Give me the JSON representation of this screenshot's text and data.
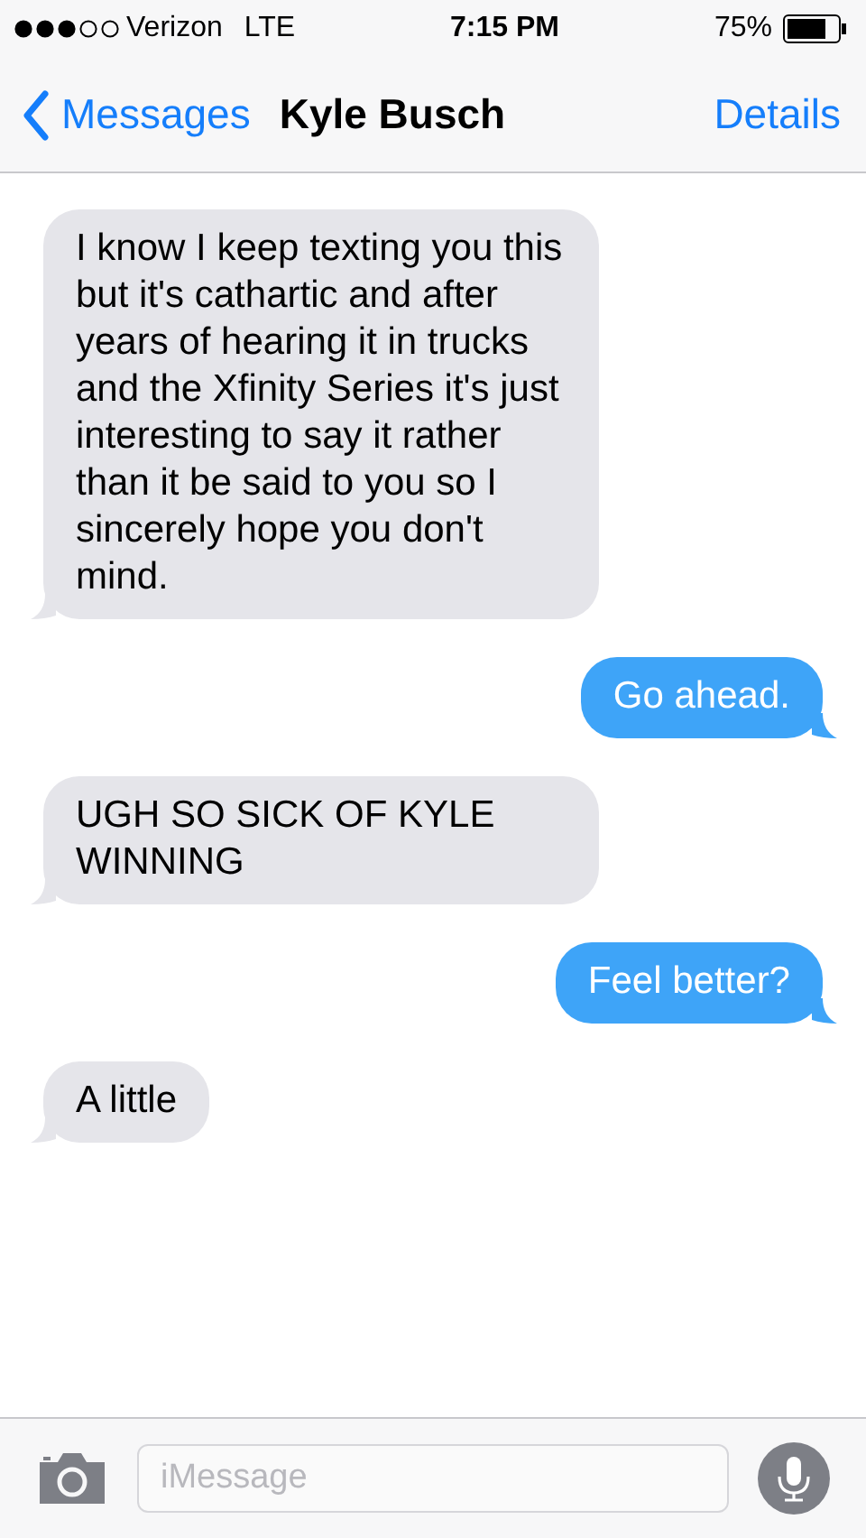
{
  "status_bar": {
    "carrier": "Verizon",
    "network": "LTE",
    "time": "7:15 PM",
    "battery": "75%"
  },
  "nav": {
    "back": "Messages",
    "title": "Kyle Busch",
    "action": "Details"
  },
  "messages": [
    {
      "kind": "received",
      "text": "I know I keep texting you this but it's cathartic and after years of hearing it in trucks and the Xfinity Series it's just interesting to say it rather than it be said to you so I sincerely hope you don't mind."
    },
    {
      "kind": "sent",
      "text": "Go ahead."
    },
    {
      "kind": "received",
      "text": "UGH SO SICK OF KYLE WINNING"
    },
    {
      "kind": "sent",
      "text": "Feel better?"
    },
    {
      "kind": "received",
      "text": "A little"
    }
  ],
  "composer": {
    "placeholder": "iMessage"
  }
}
